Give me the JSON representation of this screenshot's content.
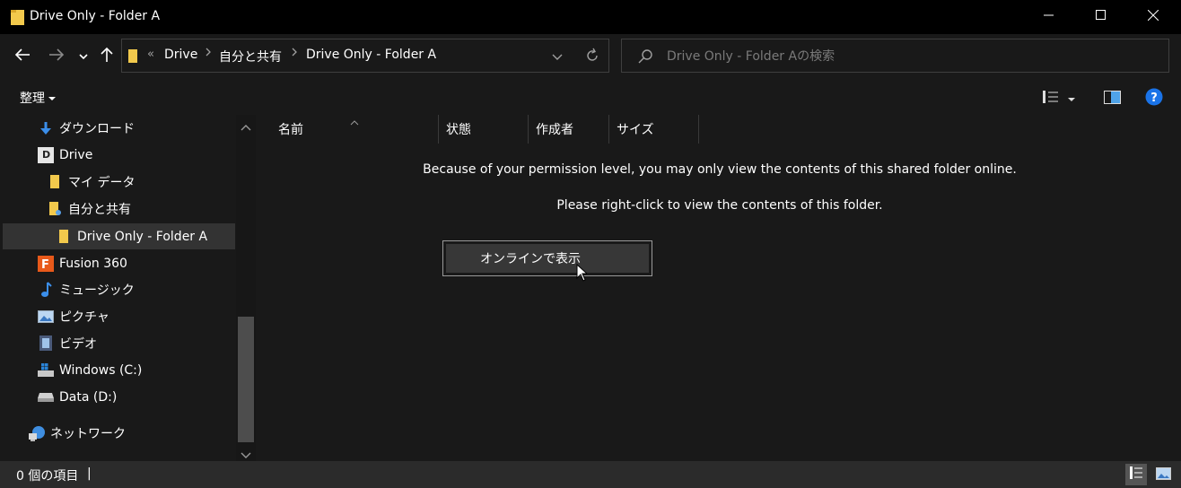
{
  "window": {
    "title": "Drive Only - Folder A",
    "controls": {
      "minimize": "minimize-icon",
      "maximize": "maximize-icon",
      "close": "close-icon"
    }
  },
  "address_bar": {
    "overflow": "«",
    "crumbs": [
      "Drive",
      "自分と共有",
      "Drive Only - Folder A"
    ]
  },
  "search": {
    "placeholder": "Drive Only - Folder Aの検索"
  },
  "command_bar": {
    "organize_label": "整理"
  },
  "nav_pane": {
    "items": [
      {
        "label": "ダウンロード",
        "icon": "download-icon"
      },
      {
        "label": "Drive",
        "icon": "drive-app-icon"
      },
      {
        "label": "マイ データ",
        "icon": "folder-icon"
      },
      {
        "label": "自分と共有",
        "icon": "shared-folder-icon"
      },
      {
        "label": "Drive Only - Folder A",
        "icon": "folder-icon",
        "selected": true
      },
      {
        "label": "Fusion 360",
        "icon": "fusion-icon"
      },
      {
        "label": "ミュージック",
        "icon": "music-icon"
      },
      {
        "label": "ピクチャ",
        "icon": "pictures-icon"
      },
      {
        "label": "ビデオ",
        "icon": "video-icon"
      },
      {
        "label": "Windows (C:)",
        "icon": "system-drive-icon"
      },
      {
        "label": "Data (D:)",
        "icon": "disk-drive-icon"
      },
      {
        "label": "ネットワーク",
        "icon": "network-icon"
      }
    ]
  },
  "columns": [
    "名前",
    "状態",
    "作成者",
    "サイズ"
  ],
  "content": {
    "message1": "Because of your permission level, you may only view the contents of this shared folder online.",
    "message2": "Please right-click to view the contents of this folder.",
    "online_button": "オンラインで表示"
  },
  "status_bar": {
    "item_count": "0 個の項目",
    "divider": "|"
  },
  "colors": {
    "background": "#191919",
    "titlebar": "#000000",
    "selected": "#333333",
    "help_blue": "#1a73e8",
    "folder_yellow": "#f2c94c"
  }
}
